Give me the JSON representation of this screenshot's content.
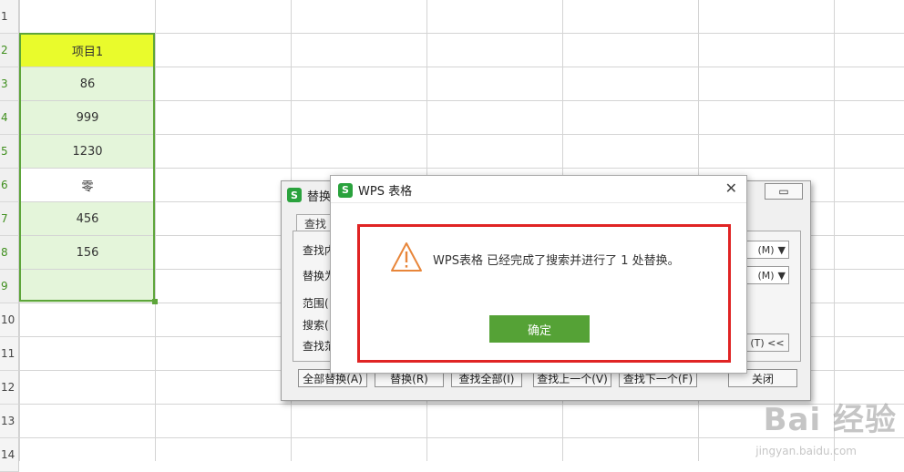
{
  "sheet": {
    "row_numbers": [
      "1",
      "2",
      "3",
      "4",
      "5",
      "6",
      "7",
      "8",
      "9",
      "10",
      "11",
      "12",
      "13",
      "14"
    ],
    "column_a": [
      "",
      "项目1",
      "86",
      "999",
      "1230",
      "零",
      "456",
      "156",
      ""
    ]
  },
  "replace_dialog": {
    "title": "替换",
    "close_label": "",
    "tab_label": "查找",
    "labels": [
      "查找内",
      "替换为",
      "范围(",
      "搜索(",
      "查找范"
    ],
    "format_combo_1": "(M)",
    "format_combo_2": "(M)",
    "options_label": "(T) <<",
    "buttons": [
      "全部替换(A)",
      "替换(R)",
      "查找全部(I)",
      "查找上一个(V)",
      "查找下一个(F)",
      "关闭"
    ]
  },
  "message_box": {
    "title": "WPS 表格",
    "message": "WPS表格 已经完成了搜索并进行了 1 处替换。",
    "ok_label": "确定",
    "close_glyph": "✕"
  },
  "watermark": {
    "brand": "Bai 经验",
    "url": "jingyan.baidu.com"
  },
  "colors": {
    "header_cell": "#e9fb2c",
    "selected_fill": "#e4f5da",
    "selection_border": "#5da53a",
    "ok_button": "#55a236",
    "highlight_box": "#e02424",
    "warning_icon": "#e8863a"
  }
}
